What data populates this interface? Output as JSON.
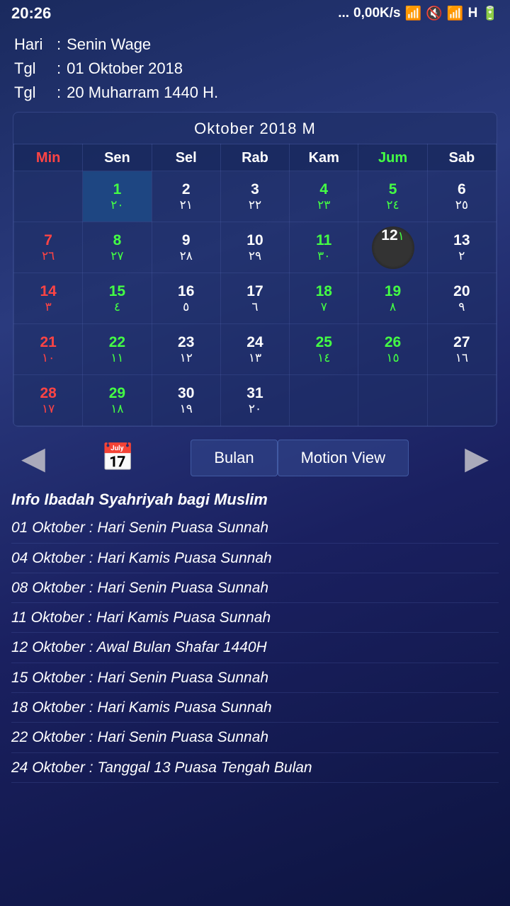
{
  "statusBar": {
    "time": "20:26",
    "network": "...",
    "speed": "0,00K/s",
    "bluetooth": "B",
    "mute": "M",
    "signal": "|||",
    "type": "H",
    "battery": "[]"
  },
  "dateInfo": {
    "hari_label": "Hari",
    "hari_val": "Senin Wage",
    "tgl_label": "Tgl",
    "tgl_val1": "01 Oktober 2018",
    "tgl_val2": "20 Muharram 1440 H."
  },
  "calendar": {
    "title": "Oktober 2018 M",
    "headers": [
      "Min",
      "Sen",
      "Sel",
      "Rab",
      "Kam",
      "Jum",
      "Sab"
    ],
    "weeks": [
      [
        {
          "greg": "",
          "hijri": "",
          "type": "empty"
        },
        {
          "greg": "1",
          "hijri": "٢٠",
          "type": "green selected"
        },
        {
          "greg": "2",
          "hijri": "٢١",
          "type": "white"
        },
        {
          "greg": "3",
          "hijri": "٢٢",
          "type": "white"
        },
        {
          "greg": "4",
          "hijri": "٢٣",
          "type": "green"
        },
        {
          "greg": "5",
          "hijri": "٢٤",
          "type": "green"
        },
        {
          "greg": "6",
          "hijri": "٢٥",
          "type": "white"
        }
      ],
      [
        {
          "greg": "7",
          "hijri": "٢٦",
          "type": "sunday"
        },
        {
          "greg": "8",
          "hijri": "٢٧",
          "type": "green"
        },
        {
          "greg": "9",
          "hijri": "٢٨",
          "type": "white"
        },
        {
          "greg": "10",
          "hijri": "٢٩",
          "type": "white"
        },
        {
          "greg": "11",
          "hijri": "٣٠",
          "type": "green"
        },
        {
          "greg": "12",
          "hijri": "١",
          "type": "today"
        },
        {
          "greg": "13",
          "hijri": "٢",
          "type": "white"
        }
      ],
      [
        {
          "greg": "14",
          "hijri": "٣",
          "type": "sunday"
        },
        {
          "greg": "15",
          "hijri": "٤",
          "type": "green"
        },
        {
          "greg": "16",
          "hijri": "٥",
          "type": "white"
        },
        {
          "greg": "17",
          "hijri": "٦",
          "type": "white"
        },
        {
          "greg": "18",
          "hijri": "٧",
          "type": "green"
        },
        {
          "greg": "19",
          "hijri": "٨",
          "type": "green"
        },
        {
          "greg": "20",
          "hijri": "٩",
          "type": "white"
        }
      ],
      [
        {
          "greg": "21",
          "hijri": "١٠",
          "type": "sunday"
        },
        {
          "greg": "22",
          "hijri": "١١",
          "type": "green"
        },
        {
          "greg": "23",
          "hijri": "١٢",
          "type": "white"
        },
        {
          "greg": "24",
          "hijri": "١٣",
          "type": "white"
        },
        {
          "greg": "25",
          "hijri": "١٤",
          "type": "green"
        },
        {
          "greg": "26",
          "hijri": "١٥",
          "type": "green"
        },
        {
          "greg": "27",
          "hijri": "١٦",
          "type": "white"
        }
      ],
      [
        {
          "greg": "28",
          "hijri": "١٧",
          "type": "sunday"
        },
        {
          "greg": "29",
          "hijri": "١٨",
          "type": "green"
        },
        {
          "greg": "30",
          "hijri": "١٩",
          "type": "white"
        },
        {
          "greg": "31",
          "hijri": "٢٠",
          "type": "white"
        },
        {
          "greg": "",
          "hijri": "",
          "type": "empty"
        },
        {
          "greg": "",
          "hijri": "",
          "type": "empty"
        },
        {
          "greg": "",
          "hijri": "",
          "type": "empty"
        }
      ]
    ]
  },
  "nav": {
    "prev_label": "◀",
    "next_label": "▶",
    "bulan_label": "Bulan",
    "motion_label": "Motion View"
  },
  "info": {
    "title": "Info Ibadah Syahriyah bagi Muslim",
    "items": [
      "01 Oktober : Hari Senin Puasa Sunnah",
      "04 Oktober : Hari Kamis Puasa Sunnah",
      "08 Oktober : Hari Senin Puasa Sunnah",
      "11 Oktober : Hari Kamis Puasa Sunnah",
      "12 Oktober : Awal Bulan Shafar 1440H",
      "15 Oktober : Hari Senin Puasa Sunnah",
      "18 Oktober : Hari Kamis Puasa Sunnah",
      "22 Oktober : Hari Senin Puasa Sunnah",
      "24 Oktober : Tanggal 13 Puasa Tengah Bulan"
    ]
  }
}
